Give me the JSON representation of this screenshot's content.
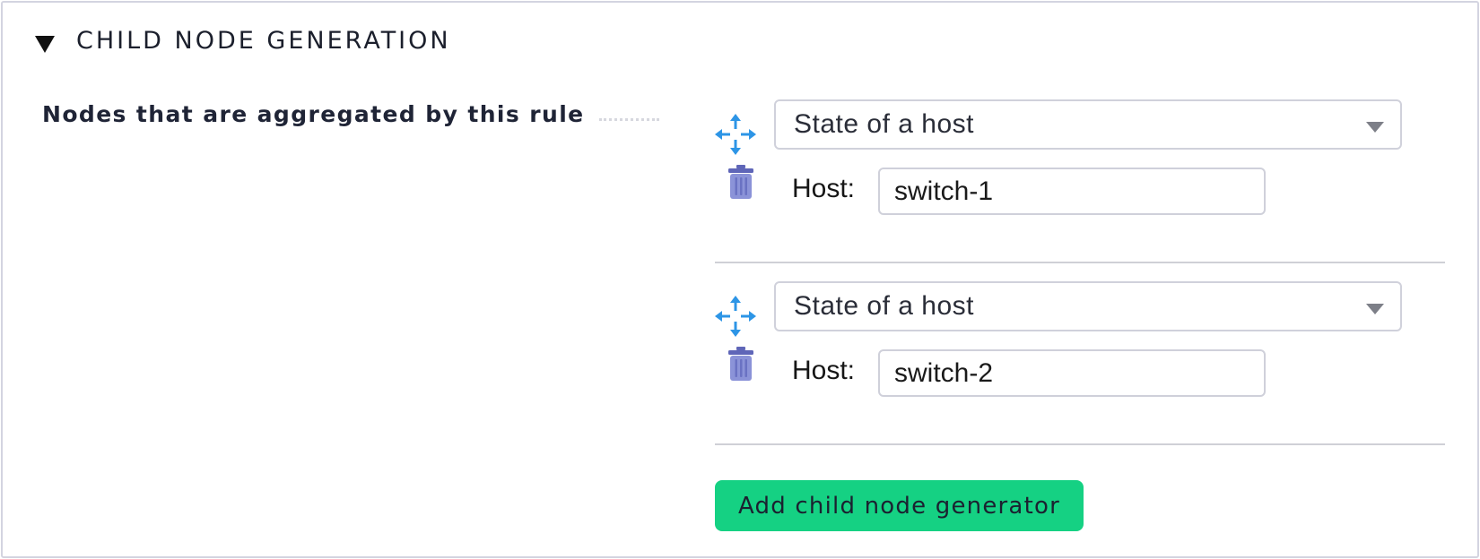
{
  "section": {
    "title": "CHILD NODE GENERATION",
    "collapse_icon": "triangle-down-icon"
  },
  "field": {
    "label": "Nodes that are aggregated by this rule"
  },
  "entries": [
    {
      "type_value": "State of a host",
      "host_label": "Host:",
      "host_value": "switch-1",
      "move_icon": "move-arrows-icon",
      "delete_icon": "trash-icon"
    },
    {
      "type_value": "State of a host",
      "host_label": "Host:",
      "host_value": "switch-2",
      "move_icon": "move-arrows-icon",
      "delete_icon": "trash-icon"
    }
  ],
  "add_button": {
    "label": "Add child node generator"
  },
  "colors": {
    "accent": "#15d183",
    "move_icon": "#2d95e6",
    "trash_icon": "#7c84cf",
    "border": "#d3d4e0"
  }
}
